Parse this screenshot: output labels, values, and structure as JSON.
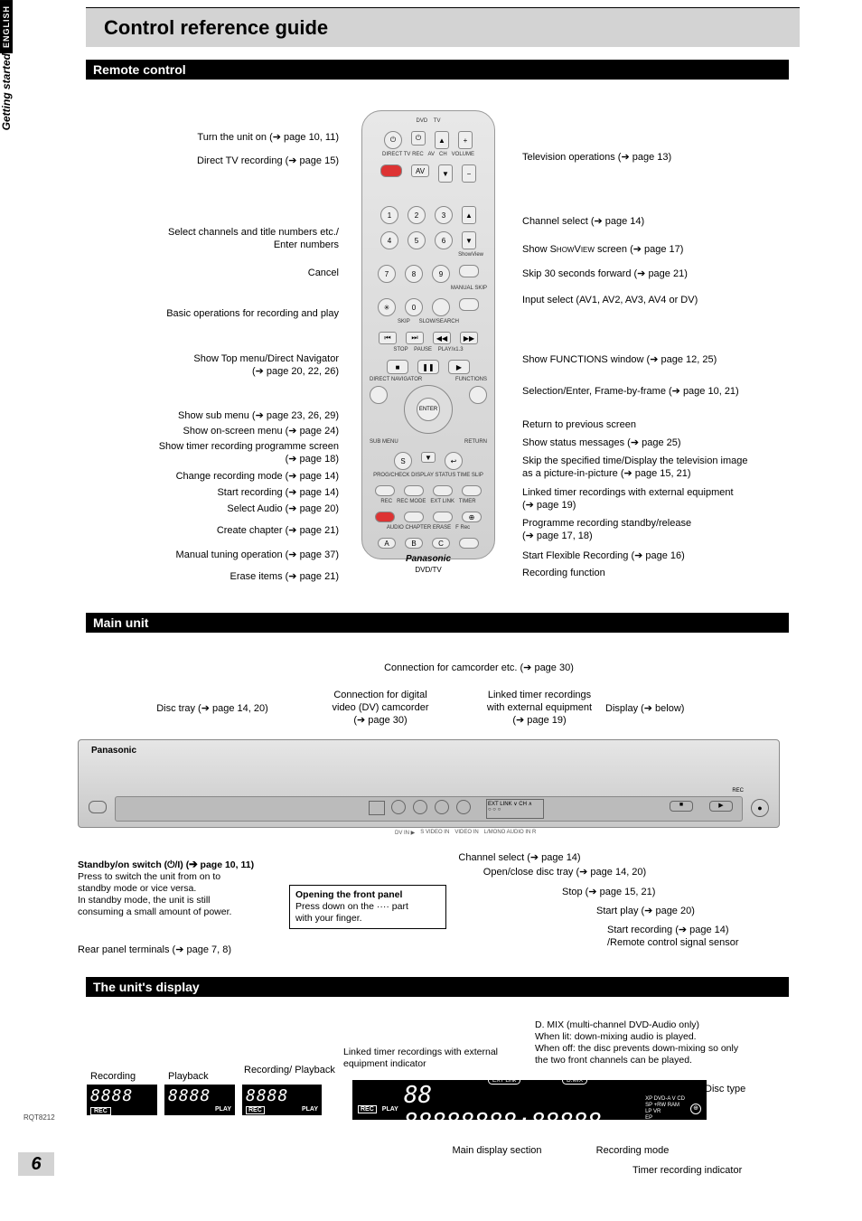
{
  "page": {
    "title": "Control reference guide",
    "side_english": "ENGLISH",
    "side_getting": "Getting started",
    "page_number": "6",
    "doc_id": "RQT8212"
  },
  "sections": {
    "remote": "Remote control",
    "main_unit": "Main unit",
    "display": "The unit's display"
  },
  "remote_left": {
    "l1": "Turn the unit on (➔ page 10, 11)",
    "l2": "Direct TV recording (➔ page 15)",
    "l3a": "Select channels and title numbers etc./",
    "l3b": "Enter numbers",
    "l4": "Cancel",
    "l5": "Basic operations for recording and play",
    "l6a": "Show Top menu/Direct Navigator",
    "l6b": "(➔ page 20, 22, 26)",
    "l7": "Show sub menu (➔ page 23, 26, 29)",
    "l8": "Show on-screen menu (➔ page 24)",
    "l9a": "Show timer recording programme screen",
    "l9b": "(➔ page 18)",
    "l10": "Change recording mode (➔ page 14)",
    "l11": "Start recording (➔ page 14)",
    "l12": "Select Audio (➔ page 20)",
    "l13": "Create chapter (➔ page 21)",
    "l14": "Manual tuning operation (➔ page 37)",
    "l15": "Erase items (➔ page 21)"
  },
  "remote_right": {
    "r1": "Television operations  (➔ page 13)",
    "r2": "Channel select (➔ page 14)",
    "r3": "Show SHOWVIEW screen (➔ page 17)",
    "r4": "Skip 30 seconds forward (➔ page 21)",
    "r5": "Input select (AV1, AV2, AV3, AV4 or DV)",
    "r6": "Show FUNCTIONS window (➔ page 12, 25)",
    "r7": "Selection/Enter, Frame-by-frame  (➔ page 10, 21)",
    "r8": "Return to previous screen",
    "r9": "Show status messages (➔ page 25)",
    "r10a": "Skip the specified time/Display the television image",
    "r10b": "as a picture-in-picture (➔ page 15, 21)",
    "r11a": "Linked timer recordings with external equipment",
    "r11b": "(➔ page 19)",
    "r12a": "Programme recording standby/release",
    "r12b": "(➔ page 17, 18)",
    "r13": "Start Flexible Recording (➔ page 16)",
    "r14": "Recording function"
  },
  "remote_device": {
    "brand": "Panasonic",
    "dvdtv": "DVD/TV"
  },
  "main_unit": {
    "top": "Connection for camcorder etc.  (➔ page 30)",
    "col1": "Disc tray (➔ page 14, 20)",
    "col2a": "Connection for digital",
    "col2b": "video (DV) camcorder",
    "col2c": "(➔ page 30)",
    "col3a": "Linked timer recordings",
    "col3b": "with external equipment",
    "col3c": "(➔ page 19)",
    "col4": "Display (➔ below)",
    "standby_title": "Standby/on switch (⏻/I) (➔ page 10, 11)",
    "standby_body1": "Press to switch the unit from on to",
    "standby_body2": "standby mode or vice versa.",
    "standby_body3": "In standby mode, the unit is still",
    "standby_body4": "consuming a small amount of power.",
    "rear": "Rear panel terminals (➔ page 7, 8)",
    "open_panel_title": "Opening the front panel",
    "open_panel_body1": "Press down on the  ····  part",
    "open_panel_body2": "with your finger.",
    "b_channel": "Channel select (➔ page 14)",
    "b_open": "Open/close disc tray (➔ page 14, 20)",
    "b_stop": "Stop (➔ page 15, 21)",
    "b_play": "Start play (➔ page 20)",
    "b_rec": "Start recording (➔ page 14)",
    "b_sensor": "/Remote control signal sensor",
    "brand": "Panasonic"
  },
  "display": {
    "dmix1": "D. MIX (multi-channel DVD-Audio only)",
    "dmix2": "When lit:   down-mixing audio is played.",
    "dmix3": "When off: the disc prevents down-mixing so only",
    "dmix4": "               the two front channels can be played.",
    "linked": "Linked timer recordings with external equipment indicator",
    "disc_type": "Disc type",
    "rec": "Recording",
    "play": "Playback",
    "recplay": "Recording/ Playback",
    "badge_rec": "REC",
    "badge_play": "PLAY",
    "ext": "EXT Link",
    "dmix_badge": "D.MIX",
    "modes": "XP DVD-A V CD\nSP +RW RAM\nLP VR\nEP",
    "main_sec": "Main display section",
    "rec_mode": "Recording mode",
    "timer_ind": "Timer recording indicator"
  }
}
